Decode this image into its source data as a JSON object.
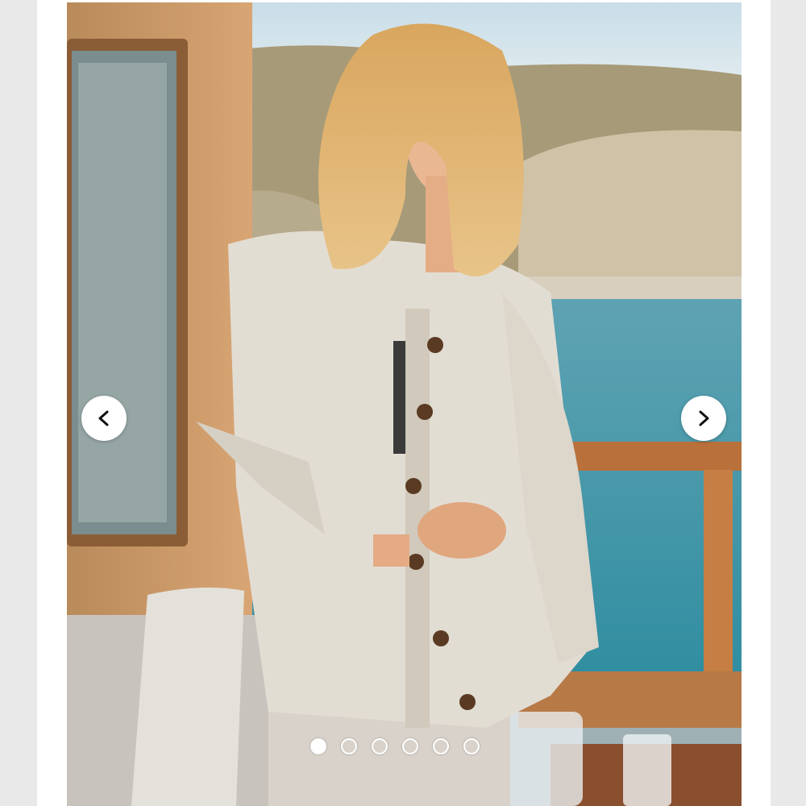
{
  "gallery": {
    "image_label": "",
    "slide_count": 6,
    "active_index": 0,
    "controls": {
      "prev_icon": "chevron-left-icon",
      "next_icon": "chevron-right-icon"
    }
  },
  "colors": {
    "page_bg": "#e9e9e9",
    "card_bg": "#ffffff",
    "nav_button_bg": "#ffffff",
    "nav_icon": "#111111",
    "dot_active": "#ffffff"
  }
}
